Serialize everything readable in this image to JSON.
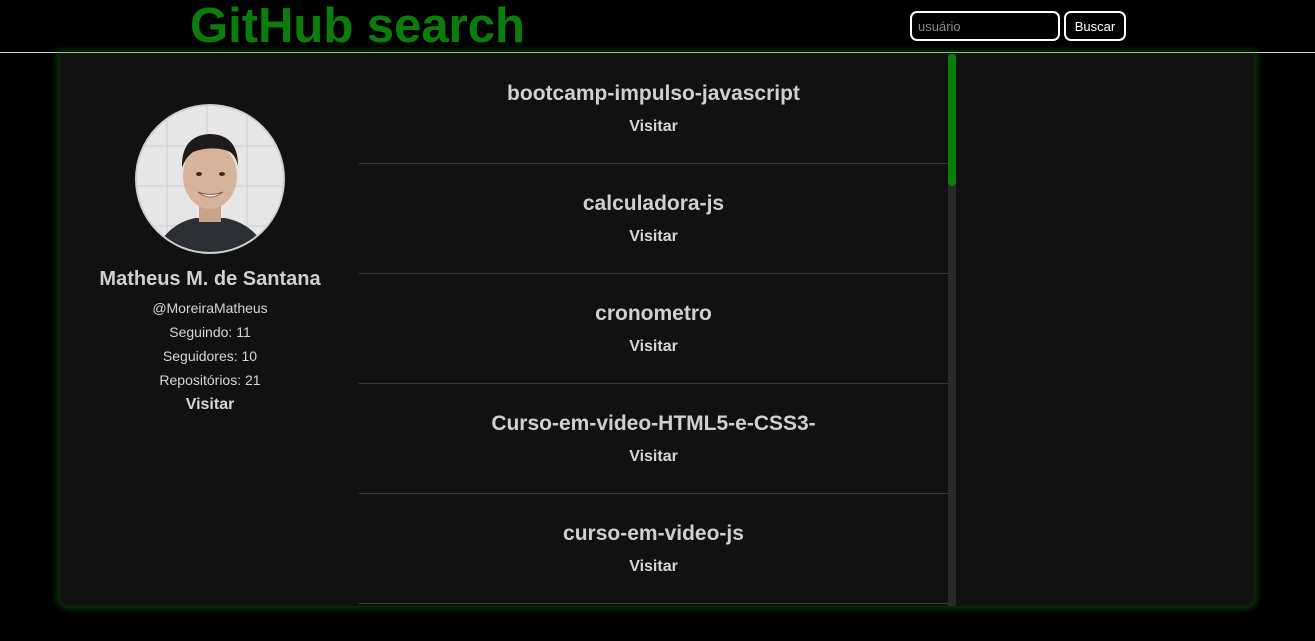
{
  "header": {
    "title": "GitHub search",
    "search_placeholder": "usuário",
    "search_value": "",
    "search_button_label": "Buscar"
  },
  "profile": {
    "name": "Matheus M. de Santana",
    "login": "@MoreiraMatheus",
    "following": "Seguindo: 11",
    "followers": "Seguidores: 10",
    "repositories": "Repositórios: 21",
    "visit_label": "Visitar"
  },
  "repos": [
    {
      "name": "bootcamp-impulso-javascript",
      "visit_label": "Visitar"
    },
    {
      "name": "calculadora-js",
      "visit_label": "Visitar"
    },
    {
      "name": "cronometro",
      "visit_label": "Visitar"
    },
    {
      "name": "Curso-em-video-HTML5-e-CSS3-",
      "visit_label": "Visitar"
    },
    {
      "name": "curso-em-video-js",
      "visit_label": "Visitar"
    }
  ],
  "colors": {
    "accent": "#0a7d0a",
    "background": "#000000",
    "panel": "#111111",
    "text": "#d6d6d6"
  }
}
